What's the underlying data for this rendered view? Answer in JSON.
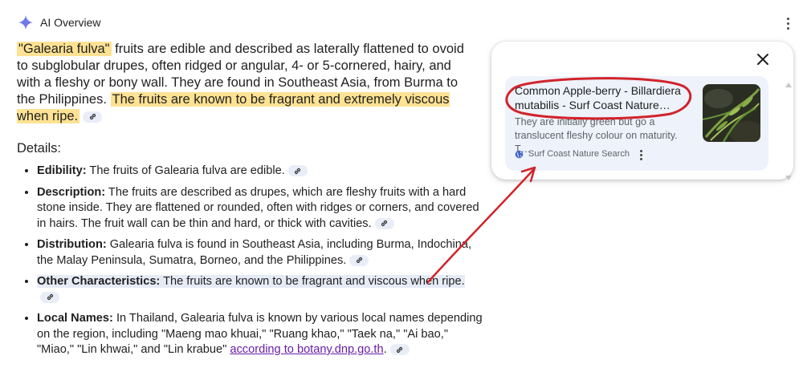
{
  "header": {
    "title": "AI Overview",
    "icon": "sparkle-icon",
    "menu_icon": "more-vert-icon"
  },
  "overview": {
    "hl_start": "\"Galearia fulva\"",
    "text_1": " fruits are edible and described as laterally flattened to ovoid to subglobular drupes, often ridged or angular, 4- or 5-cornered, hairy, and with a fleshy or bony wall. They are found in Southeast Asia, from Burma to the Philippines. ",
    "hl_end": "The fruits are known to be fragrant and extremely viscous when ripe."
  },
  "details": {
    "label": "Details:",
    "items": [
      {
        "term": "Edibility:",
        "text": " The fruits of Galearia fulva are edible."
      },
      {
        "term": "Description:",
        "text": " The fruits are described as drupes, which are fleshy fruits with a hard stone inside. They are flattened or rounded, often with ridges or corners, and covered in hairs. The fruit wall can be thin and hard, or thick with cavities."
      },
      {
        "term": "Distribution:",
        "text": " Galearia fulva is found in Southeast Asia, including Burma, Indochina, the Malay Peninsula, Sumatra, Borneo, and the Philippines."
      },
      {
        "term": "Other Characteristics:",
        "text": " The fruits are known to be fragrant and viscous when ripe."
      },
      {
        "term": "Local Names:",
        "text": " In Thailand, Galearia fulva is known by various local names depending on the region, including \"Maeng mao khuai,\" \"Ruang khao,\" \"Taek na,\" \"Ai bao,\" \"Miao,\" \"Lin khwai,\" and \"Lin krabue\" ",
        "link": "according to botany.dnp.go.th",
        "after": "."
      }
    ]
  },
  "source_panel": {
    "close_icon": "close-icon",
    "result": {
      "title": "Common Apple-berry - Billardiera mutabilis - Surf Coast Nature…",
      "snippet": "They are initially green but go a translucent fleshy colour on maturity. T…",
      "site": "Surf Coast Nature Search",
      "site_icon": "globe-icon",
      "thumbnail": "plant-photo"
    }
  },
  "colors": {
    "highlight_yellow": "#fde293",
    "highlight_blue": "#e6ecf6",
    "link_chip": "#e8edf7",
    "result_bg": "#edf2fb",
    "annotation_red": "#d2232a",
    "visited_link": "#681da8"
  }
}
